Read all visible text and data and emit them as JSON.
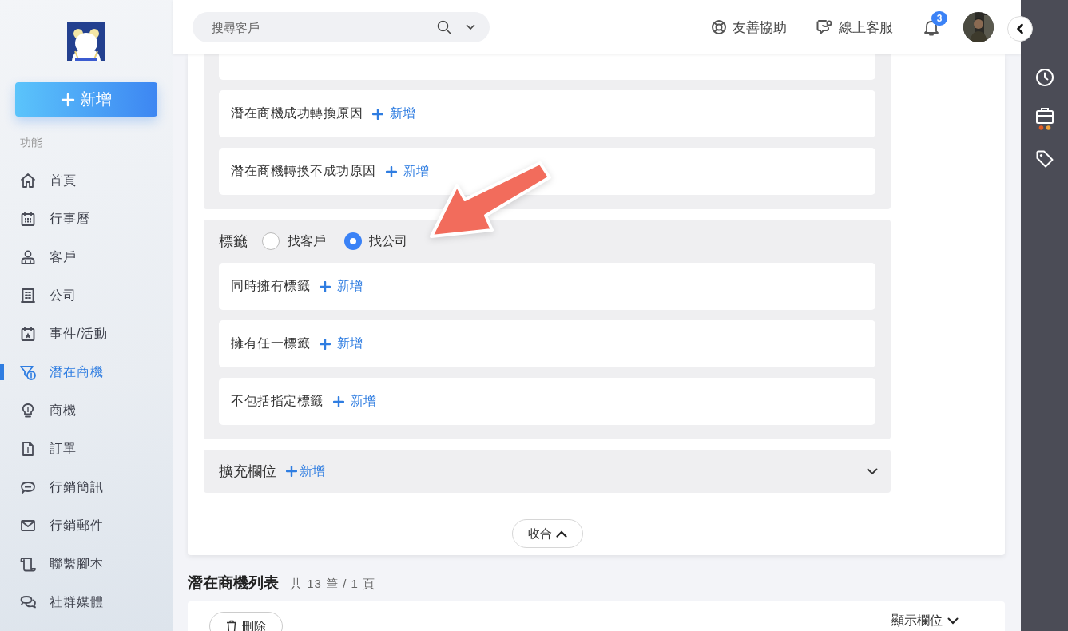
{
  "sidebar": {
    "new_button": "新增",
    "section_label": "功能",
    "items": [
      {
        "label": "首頁",
        "kind": "home",
        "selected": false
      },
      {
        "label": "行事曆",
        "kind": "calendar",
        "selected": false
      },
      {
        "label": "客戶",
        "kind": "user",
        "selected": false
      },
      {
        "label": "公司",
        "kind": "building",
        "selected": false
      },
      {
        "label": "事件/活動",
        "kind": "event",
        "selected": false
      },
      {
        "label": "潛在商機",
        "kind": "funnel",
        "selected": true
      },
      {
        "label": "商機",
        "kind": "bulb",
        "selected": false
      },
      {
        "label": "訂單",
        "kind": "invoice",
        "selected": false
      },
      {
        "label": "行銷簡訊",
        "kind": "sms",
        "selected": false
      },
      {
        "label": "行銷郵件",
        "kind": "mail",
        "selected": false
      },
      {
        "label": "聯繫腳本",
        "kind": "script",
        "selected": false
      },
      {
        "label": "社群媒體",
        "kind": "chat",
        "selected": false
      }
    ]
  },
  "header": {
    "search": {
      "placeholder": "搜尋客戶"
    },
    "links": [
      {
        "label": "友善協助",
        "kind": "help"
      },
      {
        "label": "線上客服",
        "kind": "support"
      }
    ],
    "notifications": {
      "count": "3"
    }
  },
  "filter_groups": [
    {
      "kind": "rows",
      "rows": [
        {
          "kind": "clipped"
        },
        {
          "kind": "field",
          "label": "潛在商機成功轉換原因",
          "add_label": "新增"
        },
        {
          "kind": "field",
          "label": "潛在商機轉換不成功原因",
          "add_label": "新增"
        }
      ]
    },
    {
      "kind": "rows",
      "title": "標籤",
      "radios": [
        {
          "label": "找客戶",
          "selected": false
        },
        {
          "label": "找公司",
          "selected": true
        }
      ],
      "rows": [
        {
          "kind": "field",
          "label": "同時擁有標籤",
          "add_label": "新增"
        },
        {
          "kind": "field",
          "label": "擁有任一標籤",
          "add_label": "新增"
        },
        {
          "kind": "field",
          "label": "不包括指定標籤",
          "add_label": "新增"
        }
      ]
    },
    {
      "kind": "collapsible",
      "title": "擴充欄位",
      "add_label": "新增",
      "expanded": false
    }
  ],
  "collapse_button": "收合",
  "list": {
    "title": "潛在商機列表",
    "summary": "共 13 筆 / 1 頁",
    "delete_button": "刪除",
    "columns_button": "顯示欄位"
  }
}
